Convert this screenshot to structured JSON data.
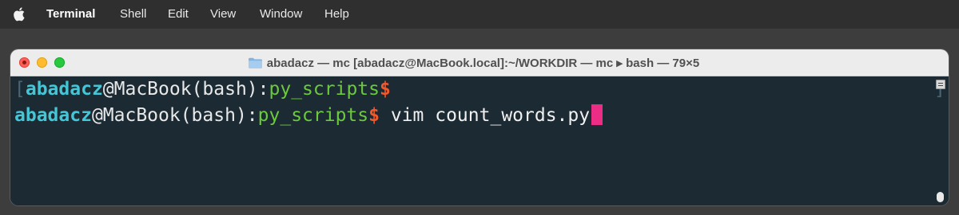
{
  "menubar": {
    "app_name": "Terminal",
    "items": [
      "Shell",
      "Edit",
      "View",
      "Window",
      "Help"
    ]
  },
  "window": {
    "title": "abadacz — mc [abadacz@MacBook.local]:~/WORKDIR — mc ▸ bash — 79×5"
  },
  "terminal": {
    "lines": [
      {
        "bracket": "[",
        "user": "abadacz",
        "host": "@MacBook(bash):",
        "path": "py_scripts",
        "prompt": "$",
        "command": ""
      },
      {
        "user": "abadacz",
        "host": "@MacBook(bash):",
        "path": "py_scripts",
        "prompt": "$",
        "command": " vim count_words.py"
      }
    ],
    "right_bracket": "]"
  },
  "colors": {
    "user": "#45c6d6",
    "path": "#6cc93e",
    "prompt": "#f1592a",
    "cursor": "#ec2d86",
    "background": "#1c2a33"
  }
}
